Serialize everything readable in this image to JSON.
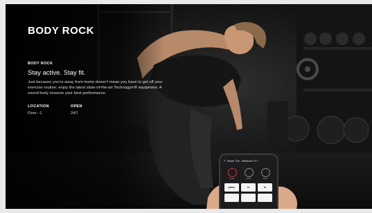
{
  "brand": {
    "title": "BODY ROCK"
  },
  "venue": {
    "name": "BODY ROCK",
    "tagline": "Stay active. Stay fit.",
    "description": "Just because you’re away from home doesn’t mean you have to get off your exercise routine; enjoy the latest state-of-the-art Technogym® equipment. A sound body ensures your best performance.",
    "location_label": "LOCATION",
    "location_value": "Floor: -1",
    "open_label": "OPEN",
    "open_value": "24/7"
  },
  "phone": {
    "header_title": "Room TVs - Bedroom TV ›",
    "buttons": [
      {
        "label": "Power"
      },
      {
        "label": "Guide"
      },
      {
        "label": "Menu"
      }
    ],
    "apps": [
      "prime",
      "tv",
      "tv",
      "",
      "",
      ""
    ]
  },
  "colors": {
    "background": "#060606",
    "power_accent": "#c43a3a"
  }
}
